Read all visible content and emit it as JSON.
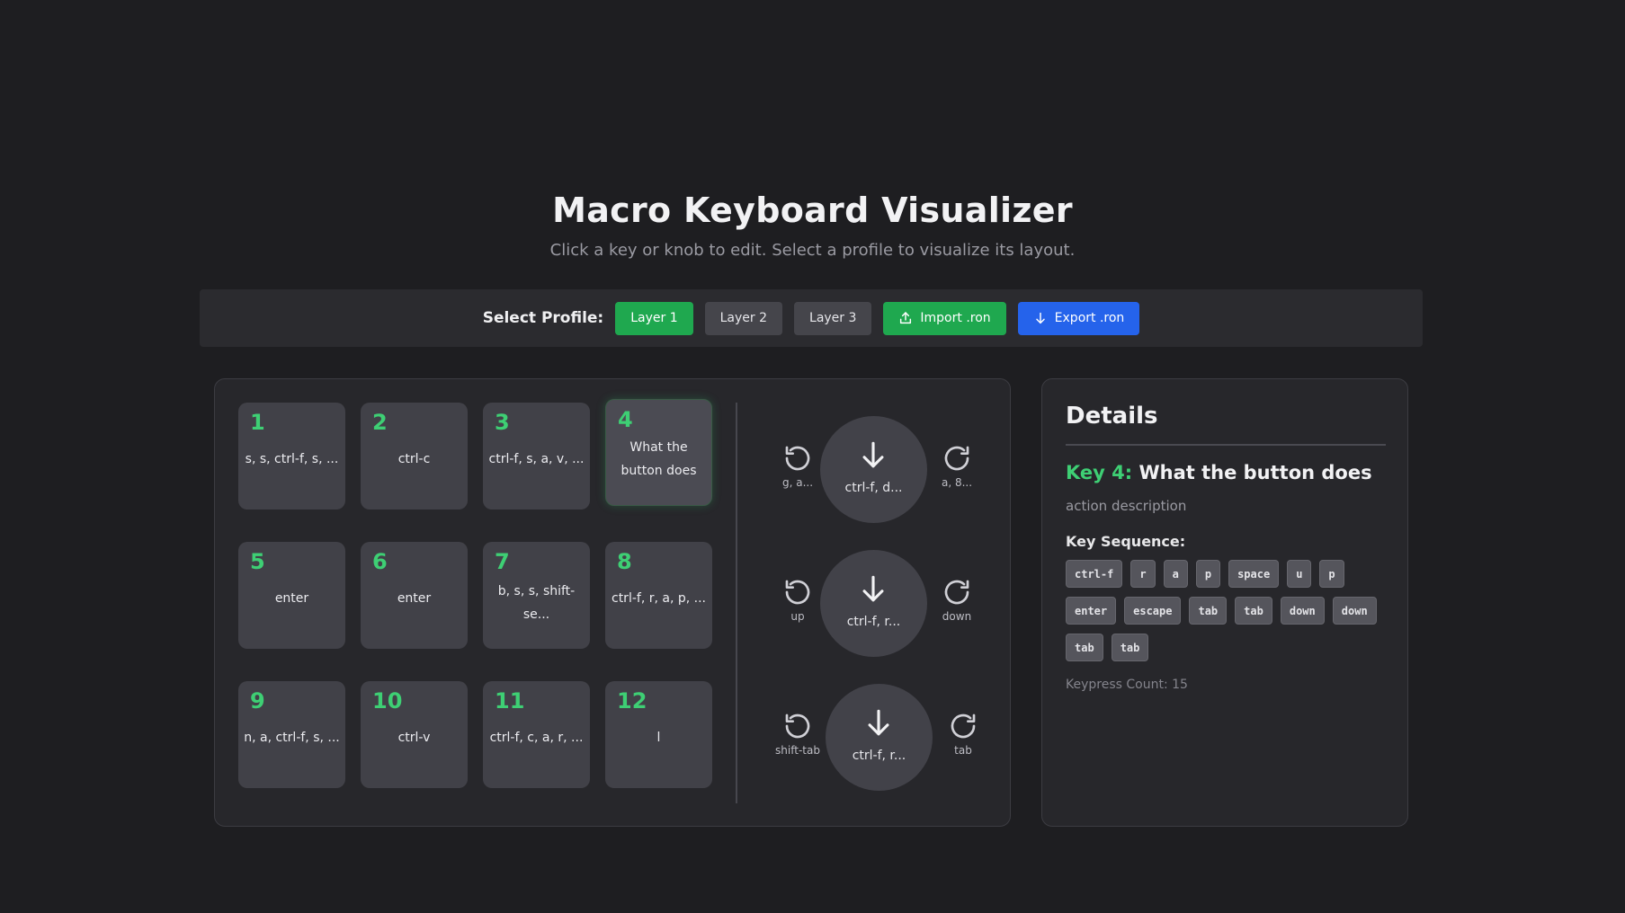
{
  "header": {
    "title": "Macro Keyboard Visualizer",
    "subtitle": "Click a key or knob to edit. Select a profile to visualize its layout."
  },
  "toolbar": {
    "label": "Select Profile:",
    "profiles": [
      "Layer 1",
      "Layer 2",
      "Layer 3"
    ],
    "active_profile": "Layer 1",
    "import_label": "Import .ron",
    "export_label": "Export .ron",
    "import_icon": "upload-icon",
    "export_icon": "download-arrow-icon"
  },
  "keys": [
    {
      "num": "1",
      "label": "s, s, ctrl-f, s, ..."
    },
    {
      "num": "2",
      "label": "ctrl-c"
    },
    {
      "num": "3",
      "label": "ctrl-f, s, a, v, ..."
    },
    {
      "num": "4",
      "label": "What the button does",
      "selected": true
    },
    {
      "num": "5",
      "label": "enter"
    },
    {
      "num": "6",
      "label": "enter"
    },
    {
      "num": "7",
      "label": "b, s, s, shift-se..."
    },
    {
      "num": "8",
      "label": "ctrl-f, r, a, p, ..."
    },
    {
      "num": "9",
      "label": "n, a, ctrl-f, s, ..."
    },
    {
      "num": "10",
      "label": "ctrl-v"
    },
    {
      "num": "11",
      "label": "ctrl-f, c, a, r, ..."
    },
    {
      "num": "12",
      "label": "l"
    }
  ],
  "knobs": [
    {
      "press": "ctrl-f, d...",
      "left": "g, a...",
      "right": "a, 8..."
    },
    {
      "press": "ctrl-f, r...",
      "left": "up",
      "right": "down"
    },
    {
      "press": "ctrl-f, r...",
      "left": "shift-tab",
      "right": "tab"
    }
  ],
  "knob_icons": {
    "press": "arrow-down-icon",
    "left": "rotate-ccw-icon",
    "right": "rotate-cw-icon"
  },
  "details": {
    "title": "Details",
    "key_id": "Key 4:",
    "key_name": "What the button does",
    "description": "action description",
    "sequence_label": "Key Sequence:",
    "sequence": [
      "ctrl-f",
      "r",
      "a",
      "p",
      "space",
      "u",
      "p",
      "enter",
      "escape",
      "tab",
      "tab",
      "down",
      "down",
      "tab",
      "tab"
    ],
    "count_text": "Keypress Count: 15"
  },
  "colors": {
    "accent_green": "#3ecf74",
    "active_button": "#1fa84f",
    "export_button": "#2563eb",
    "background": "#1e1e21"
  }
}
